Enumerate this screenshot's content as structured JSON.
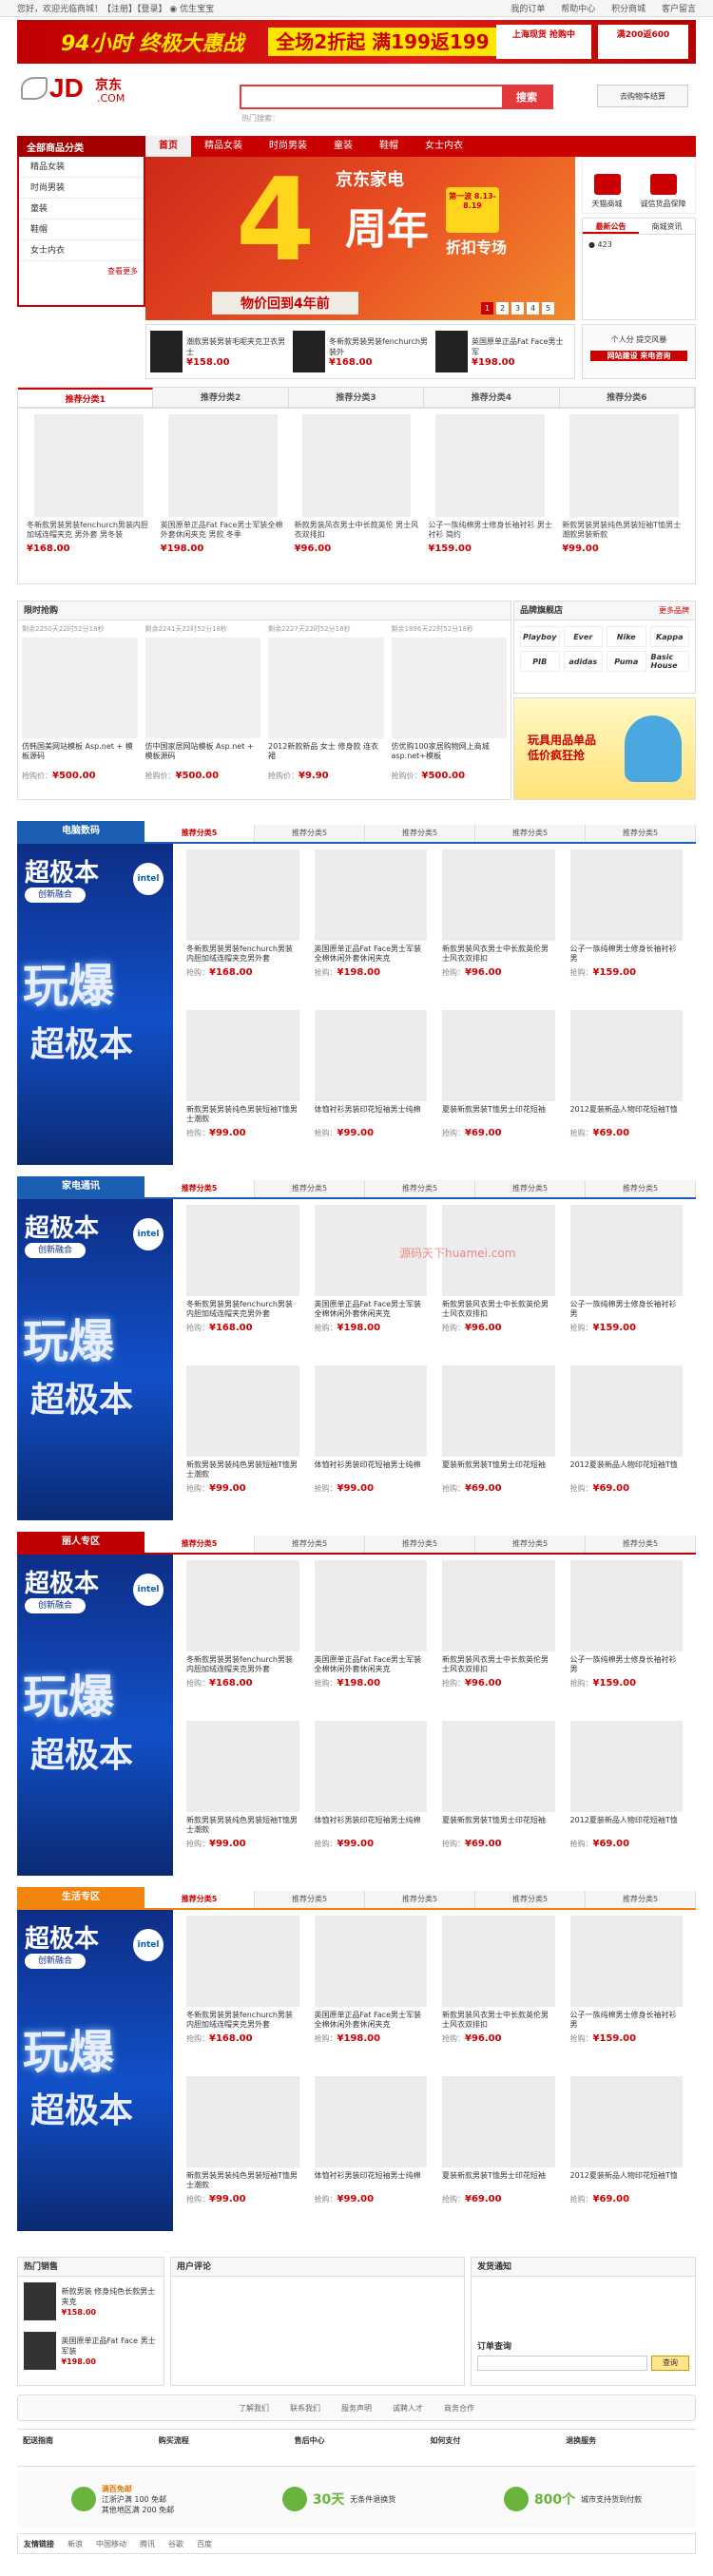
{
  "topbar": {
    "left": "您好，欢迎光临商城！【注册】【登录】 ◉ 优生宝宝",
    "right": [
      "我的订单",
      "帮助中心",
      "积分商城",
      "客户留言"
    ]
  },
  "promo": {
    "text1": "94小时 终极大惠战",
    "text2": "全场2折起 满199返199",
    "box1": "上海现货 抢购中",
    "box2": "满200返600"
  },
  "logo": {
    "main": "JD",
    "cn": "京东",
    "com": ".COM"
  },
  "search": {
    "placeholder": "",
    "button": "搜索",
    "hot": "热门搜索："
  },
  "cart": {
    "label": "去购物车结算"
  },
  "nav": {
    "all": "全部商品分类",
    "items": [
      "首页",
      "精品女装",
      "时尚男装",
      "童装",
      "鞋帽",
      "女士内衣"
    ]
  },
  "cats": [
    "精品女装",
    "时尚男装",
    "童装",
    "鞋帽",
    "女士内衣"
  ],
  "cats_more": "查看更多",
  "banner": {
    "t1": "京东家电",
    "big": "4",
    "t2": "周年",
    "badge": "第一波 8.13-8.19",
    "t4": "折扣专场",
    "t5": "物价回到4年前",
    "pages": [
      "1",
      "2",
      "3",
      "4",
      "5"
    ]
  },
  "right": {
    "icons": [
      "天猫商城",
      "诚信货品保障"
    ],
    "tabs": [
      "最新公告",
      "商城资讯"
    ],
    "news": "● 423"
  },
  "mini": [
    {
      "name": "潮款男装男装毛呢夹克卫衣男士",
      "price": "¥158.00"
    },
    {
      "name": "冬新款男装男装fenchurch男装外",
      "price": "¥168.00"
    },
    {
      "name": "英国原单正品Fat Face男士军",
      "price": "¥198.00"
    }
  ],
  "sidead": {
    "t": "个人分 提交风暴",
    "b": "网站建设 来电咨询"
  },
  "rec": {
    "tabs": [
      "推荐分类1",
      "推荐分类2",
      "推荐分类3",
      "推荐分类4",
      "推荐分类6"
    ],
    "items": [
      {
        "name": "冬新款男装男装fenchurch男装内胆加绒连帽夹克 男外套 男冬装",
        "price": "¥168.00"
      },
      {
        "name": "英国原单正品Fat Face男士军装全棉外套休闲夹克 男款 冬季",
        "price": "¥198.00"
      },
      {
        "name": "新款男装风衣男士中长款英伦 男士风衣双排扣",
        "price": "¥96.00"
      },
      {
        "name": "公子一族纯棉男士修身长袖衬衫 男士衬衫 简约",
        "price": "¥159.00"
      },
      {
        "name": "新款男装男装纯色男装短袖T恤男士 潮款男装新款",
        "price": "¥99.00"
      }
    ]
  },
  "row2": {
    "header": "限时抢购",
    "items": [
      {
        "cd": "剩余2250天22时52分18秒",
        "name": "仿韩国美网站模板 Asp.net + 模板源码",
        "price": "¥500.00"
      },
      {
        "name": "仿中国家居网站模板 Asp.net + 模板源码",
        "cd": "剩余2241天22时52分18秒",
        "price": "¥500.00"
      },
      {
        "cd": "剩余2227天22时52分18秒",
        "name": "2012新款新品 女士 修身款 连衣裙",
        "price": "¥9.90"
      },
      {
        "cd": "剩余1896天22时52分18秒",
        "name": "仿优购100家居购物网上商城 asp.net+模板",
        "price": "¥500.00"
      }
    ],
    "pricelabel": "抢购价："
  },
  "brands": {
    "header": "品牌旗舰店",
    "more": "更多品牌",
    "list": [
      "Playboy",
      "Ever",
      "Nike",
      "Kappa",
      "PIB",
      "adidas",
      "Puma",
      "Basic House"
    ]
  },
  "toyad": {
    "t1": "玩具用品单品",
    "t2": "低价疯狂抢"
  },
  "floors": [
    {
      "name": "电脑数码",
      "color": "#1a5fb4",
      "tabs": [
        "推荐分类5",
        "推荐分类5",
        "推荐分类5",
        "推荐分类5",
        "推荐分类5"
      ]
    },
    {
      "name": "家电通讯",
      "color": "#1a5fb4",
      "tabs": [
        "推荐分类5",
        "推荐分类5",
        "推荐分类5",
        "推荐分类5",
        "推荐分类5"
      ]
    },
    {
      "name": "丽人专区",
      "color": "#c00000",
      "tabs": [
        "推荐分类5",
        "推荐分类5",
        "推荐分类5",
        "推荐分类5",
        "推荐分类5"
      ]
    },
    {
      "name": "生活专区",
      "color": "#f2830d",
      "tabs": [
        "推荐分类5",
        "推荐分类5",
        "推荐分类5",
        "推荐分类5",
        "推荐分类5"
      ]
    }
  ],
  "floorad": {
    "a1": "超极本",
    "a2": "创新融合",
    "a3": "intel",
    "a4": "玩爆",
    "a5": "超极本"
  },
  "floorprods": [
    {
      "name": "冬新款男装男装fenchurch男装内胆加绒连帽夹克男外套",
      "price": "¥168.00"
    },
    {
      "name": "英国原单正品Fat Face男士军装全棉休闲外套休闲夹克",
      "price": "¥198.00"
    },
    {
      "name": "新款男装风衣男士中长款英伦男士风衣双排扣",
      "price": "¥96.00"
    },
    {
      "name": "公子一族纯棉男士修身长袖衬衫男",
      "price": "¥159.00"
    },
    {
      "name": "新款男装男装纯色男装短袖T恤男士潮款",
      "price": "¥99.00"
    },
    {
      "name": "体恤衬衫男装印花短袖男士纯棉",
      "price": "¥99.00"
    },
    {
      "name": "夏装新款男装T恤男士印花短袖",
      "price": "¥69.00"
    },
    {
      "name": "2012夏装新品人物印花短袖T恤",
      "price": "¥69.00"
    }
  ],
  "floorpricelabel": "抢购：",
  "bottom": {
    "hot": "热门销售",
    "comments": "用户评论",
    "notice": "发货通知",
    "order": "订单查询",
    "query": "查询",
    "hotitems": [
      {
        "name": "新款男装 修身纯色长款男士夹克",
        "price": "¥158.00"
      },
      {
        "name": "英国原单正品Fat Face 男士军装",
        "price": "¥198.00"
      }
    ]
  },
  "links": [
    "了解我们",
    "联系我们",
    "服务声明",
    "诚聘人才",
    "商务合作"
  ],
  "help": [
    "配送指南",
    "购买流程",
    "售后中心",
    "如何支付",
    "退换服务"
  ],
  "serv": [
    {
      "t1": "满百免邮",
      "t2": "江浙沪满 100 免邮",
      "t3": "其他地区满 200 免邮"
    },
    {
      "big": "30天",
      "t": "无条件退换货"
    },
    {
      "big": "800个",
      "t": "城市支持货到付款"
    }
  ],
  "friend": {
    "title": "友情链接",
    "items": [
      "新浪",
      "中国移动",
      "腾讯",
      "谷歌",
      "百度"
    ]
  },
  "watermark": "源码天下huamei.com"
}
